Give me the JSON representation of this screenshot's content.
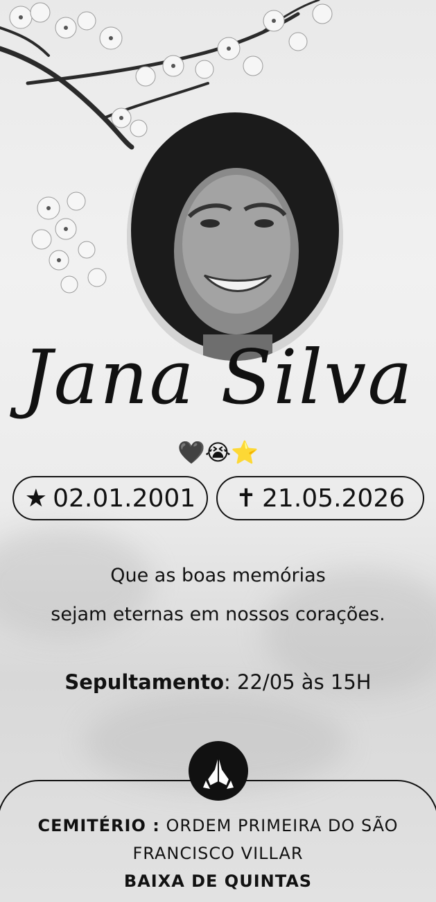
{
  "name": "Jana Silva",
  "emojis": "🖤😭⭐",
  "birth": {
    "icon_name": "star-icon",
    "icon": "★",
    "date": "02.01.2001"
  },
  "death": {
    "icon_name": "cross-icon",
    "icon": "✝",
    "date": "21.05.2026"
  },
  "message": {
    "line1": "Que as boas memórias",
    "line2": "sejam eternas em nossos corações."
  },
  "burial": {
    "label": "Sepultamento",
    "value": ": 22/05 às 15H"
  },
  "cemetery": {
    "label": "CEMITÉRIO :",
    "name_line1": "ORDEM PRIMEIRA DO SÃO",
    "name_line2": "FRANCISCO VILLAR",
    "district": "BAIXA DE QUINTAS",
    "icon_name": "praying-hands-icon"
  }
}
